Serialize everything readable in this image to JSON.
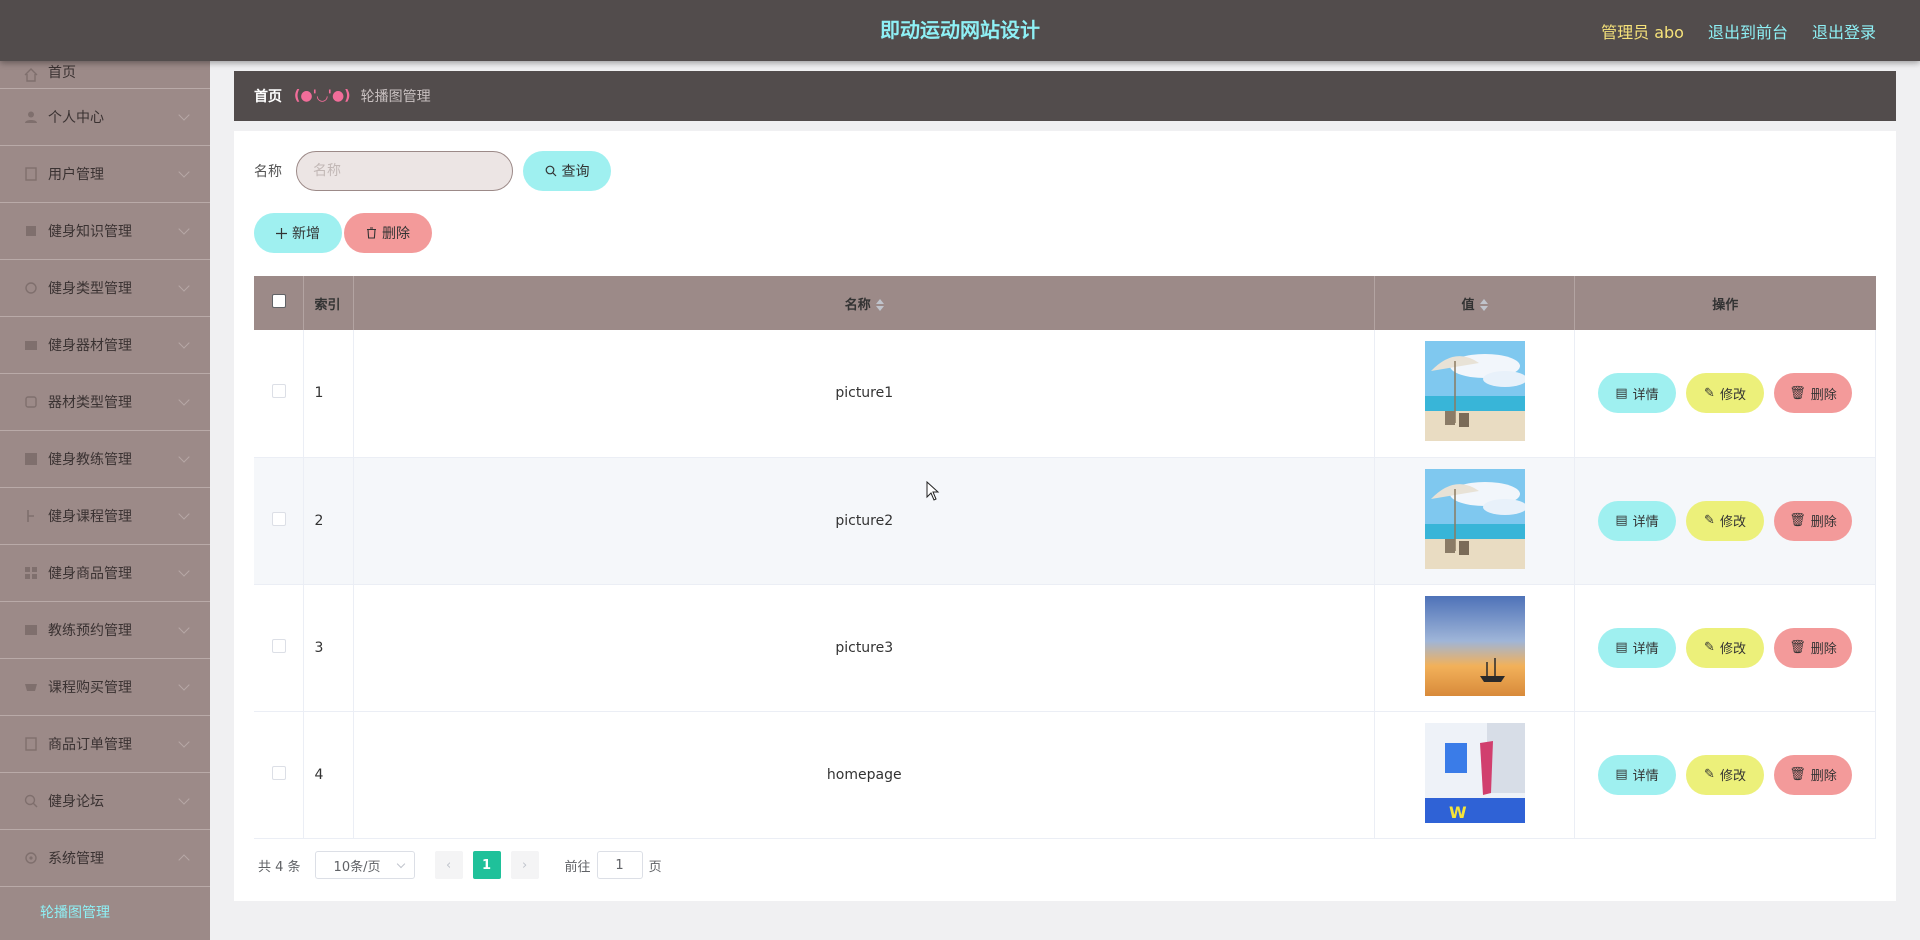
{
  "header": {
    "title": "即动运动网站设计",
    "admin": "管理员 abo",
    "to_front": "退出到前台",
    "logout": "退出登录"
  },
  "sidebar": {
    "items": [
      {
        "label": "首页",
        "icon": "home-icon"
      },
      {
        "label": "个人中心",
        "icon": "user-icon"
      },
      {
        "label": "用户管理",
        "icon": "users-icon"
      },
      {
        "label": "健身知识管理",
        "icon": "book-icon"
      },
      {
        "label": "健身类型管理",
        "icon": "category-icon"
      },
      {
        "label": "健身器材管理",
        "icon": "equipment-icon"
      },
      {
        "label": "器材类型管理",
        "icon": "tag-icon"
      },
      {
        "label": "健身教练管理",
        "icon": "coach-icon"
      },
      {
        "label": "健身课程管理",
        "icon": "course-icon"
      },
      {
        "label": "健身商品管理",
        "icon": "goods-icon"
      },
      {
        "label": "教练预约管理",
        "icon": "calendar-icon"
      },
      {
        "label": "课程购买管理",
        "icon": "cart-icon"
      },
      {
        "label": "商品订单管理",
        "icon": "order-icon"
      },
      {
        "label": "健身论坛",
        "icon": "forum-icon"
      },
      {
        "label": "系统管理",
        "icon": "settings-icon"
      }
    ],
    "sub_active": "轮播图管理"
  },
  "breadcrumb": {
    "home": "首页",
    "face": "(●'◡'●)",
    "current": "轮播图管理"
  },
  "search": {
    "label": "名称",
    "placeholder": "名称",
    "query": "查询"
  },
  "actions": {
    "add": "新增",
    "delete": "删除"
  },
  "table": {
    "headers": {
      "index": "索引",
      "name": "名称",
      "value": "值",
      "ops": "操作"
    },
    "rows": [
      {
        "index": "1",
        "name": "picture1",
        "image": "beach-umbrella-image"
      },
      {
        "index": "2",
        "name": "picture2",
        "image": "beach-umbrella-image"
      },
      {
        "index": "3",
        "name": "picture3",
        "image": "sunset-boat-image"
      },
      {
        "index": "4",
        "name": "homepage",
        "image": "fitness-poster-image"
      }
    ],
    "op_labels": {
      "detail": "详情",
      "edit": "修改",
      "delete": "删除"
    }
  },
  "pagination": {
    "total": "共 4 条",
    "page_size": "10条/页",
    "current": "1",
    "goto_prefix": "前往",
    "goto_value": "1",
    "goto_suffix": "页"
  },
  "colors": {
    "header_bg": "#524c4c",
    "sidebar_bg": "#9c8a88",
    "accent_cyan": "#9ff0f0",
    "accent_red": "#f39a9a",
    "accent_yellow": "#ecf07a",
    "pager_active": "#1fc19a"
  }
}
